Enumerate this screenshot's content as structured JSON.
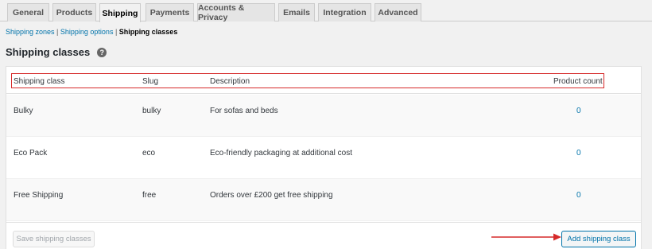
{
  "tabs": [
    {
      "label": "General"
    },
    {
      "label": "Products"
    },
    {
      "label": "Shipping"
    },
    {
      "label": "Payments"
    },
    {
      "label": "Accounts & Privacy"
    },
    {
      "label": "Emails"
    },
    {
      "label": "Integration"
    },
    {
      "label": "Advanced"
    }
  ],
  "subnav": {
    "zones": "Shipping zones",
    "sep1": " | ",
    "options": "Shipping options",
    "sep2": " | ",
    "classes": "Shipping classes"
  },
  "page": {
    "title": "Shipping classes",
    "help_icon": "help-icon"
  },
  "table": {
    "headers": {
      "class": "Shipping class",
      "slug": "Slug",
      "description": "Description",
      "count": "Product count"
    },
    "rows": [
      {
        "name": "Bulky",
        "slug": "bulky",
        "description": "For sofas and beds",
        "count": "0"
      },
      {
        "name": "Eco Pack",
        "slug": "eco",
        "description": "Eco-friendly packaging at additional cost",
        "count": "0"
      },
      {
        "name": "Free Shipping",
        "slug": "free",
        "description": "Orders over £200 get free shipping",
        "count": "0"
      }
    ]
  },
  "footer": {
    "save_label": "Save shipping classes",
    "add_label": "Add shipping class"
  },
  "colors": {
    "accent": "#0073aa",
    "annotation": "#d62a2a"
  }
}
